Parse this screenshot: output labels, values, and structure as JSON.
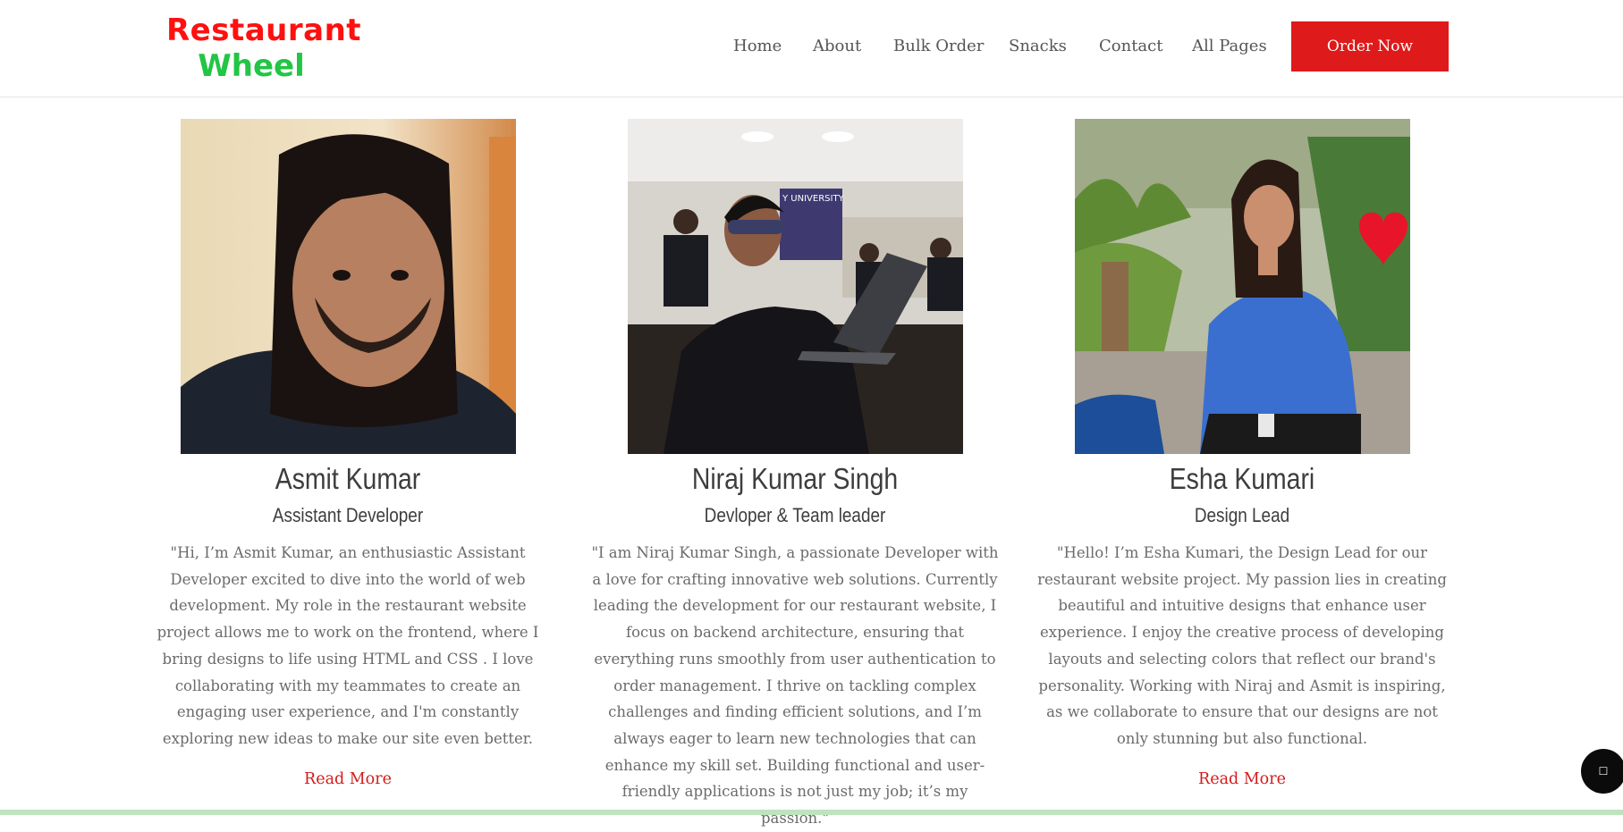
{
  "header": {
    "logo_line1": "Restaurant",
    "logo_line2": "Wheel",
    "nav": [
      "Home",
      "About",
      "Bulk Order",
      "Snacks",
      "Contact",
      "All Pages"
    ],
    "order_button": "Order Now"
  },
  "team": [
    {
      "name": "Asmit Kumar",
      "role": "Assistant Developer",
      "bio": "\"Hi, I’m Asmit Kumar, an enthusiastic Assistant Developer excited to dive into the world of web development. My role in the restaurant website project allows me to work on the frontend, where I bring designs to life using HTML and CSS . I love collaborating with my teammates to create an engaging user experience, and I'm constantly exploring new ideas to make our site even better.",
      "read_more": "Read More"
    },
    {
      "name": "Niraj Kumar Singh",
      "role": "Devloper & Team leader",
      "bio": "\"I am Niraj Kumar Singh, a passionate Developer with a love for crafting innovative web solutions. Currently leading the development for our restaurant website, I focus on backend architecture, ensuring that everything runs smoothly from user authentication to order management. I thrive on tackling complex challenges and finding efficient solutions, and I’m always eager to learn new technologies that can enhance my skill set. Building functional and user-friendly applications is not just my job; it’s my passion.\"",
      "photo_text": "Y UNIVERSITY"
    },
    {
      "name": "Esha Kumari",
      "role": "Design Lead",
      "bio": "\"Hello! I’m Esha Kumari, the Design Lead for our restaurant website project. My passion lies in creating beautiful and intuitive designs that enhance user experience. I enjoy the creative process of developing layouts and selecting colors that reflect our brand's personality. Working with Niraj and Asmit is inspiring, as we collaborate to ensure that our designs are not only stunning but also functional.",
      "read_more": "Read More"
    }
  ],
  "chat_icon": "chat-icon",
  "colors": {
    "accent": "#df1a1a",
    "logo_red": "#ff1010",
    "logo_green": "#22c544"
  }
}
